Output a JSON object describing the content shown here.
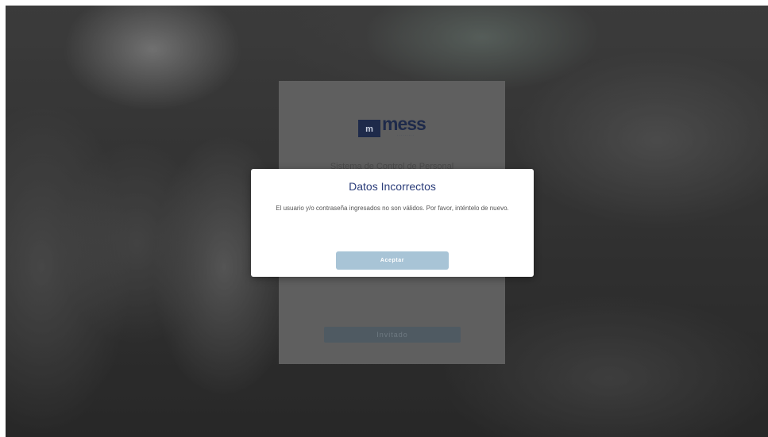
{
  "login": {
    "logo_mark": "m",
    "logo_word": "mess",
    "subtitle": "Sistema de Control de Personal",
    "button_label": "Invitado"
  },
  "dialog": {
    "title": "Datos Incorrectos",
    "message": "El usuario y/o contraseña ingresados no son válidos. Por favor, inténtelo de nuevo.",
    "button_label": "Aceptar"
  },
  "colors": {
    "dialog_title": "#2b3d7a",
    "accept_button": "#a8c4d6",
    "logo_navy": "#1e2a4a"
  }
}
